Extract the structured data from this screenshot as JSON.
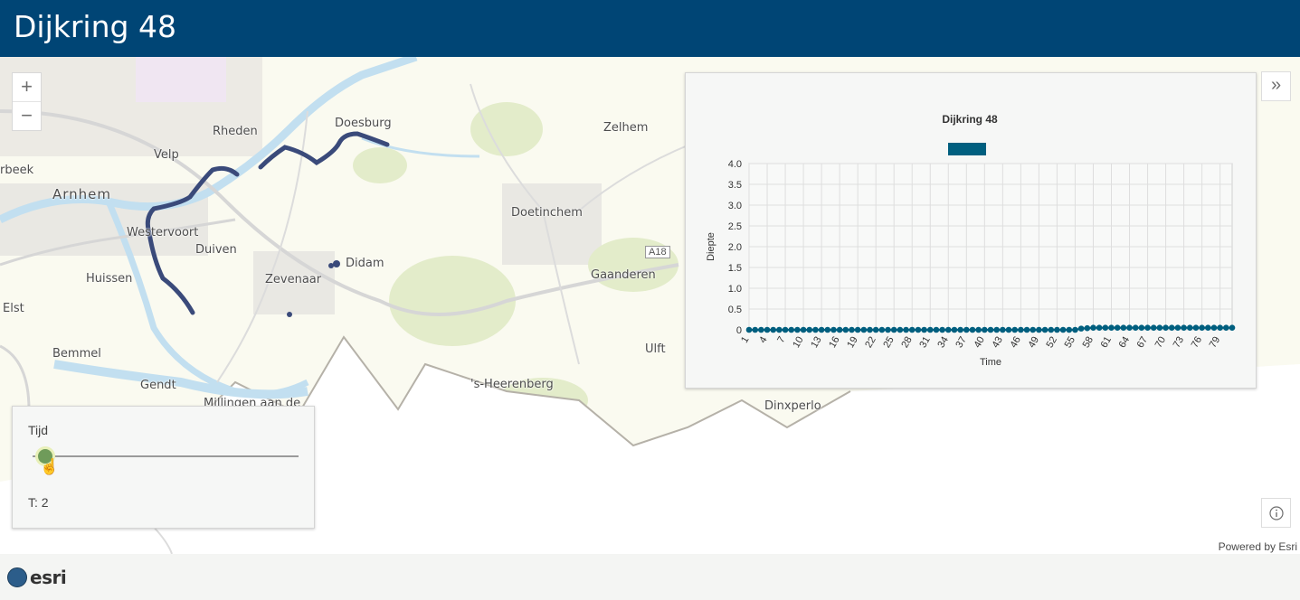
{
  "header": {
    "title": "Dijkring 48"
  },
  "map": {
    "places": {
      "doesburg": "Doesburg",
      "rheden": "Rheden",
      "velp": "Velp",
      "arnhem": "Arnhem",
      "rbeek": "rbeek",
      "westervoort": "Westervoort",
      "duiven": "Duiven",
      "didam": "Didam",
      "zevenaar": "Zevenaar",
      "huissen": "Huissen",
      "elst": "Elst",
      "bemmel": "Bemmel",
      "gendt": "Gendt",
      "millingen": "Millingen aan de",
      "doetinchem": "Doetinchem",
      "zelhem": "Zelhem",
      "gaanderen": "Gaanderen",
      "ulft": "Ulft",
      "heerenberg": "'s-Heerenberg",
      "dinxperlo": "Dinxperlo"
    },
    "road_shield": "A18",
    "zoom_in": "+",
    "zoom_out": "−"
  },
  "chart_data": {
    "type": "line",
    "title": "Dijkring 48",
    "xlabel": "Time",
    "ylabel": "Diepte",
    "ylim": [
      0,
      4.0
    ],
    "yticks": [
      "4.0",
      "3.5",
      "3.0",
      "2.5",
      "2.0",
      "1.5",
      "1.0",
      "0.5",
      "0"
    ],
    "xtick_labels": [
      "1",
      "4",
      "7",
      "10",
      "13",
      "16",
      "19",
      "22",
      "25",
      "28",
      "31",
      "34",
      "37",
      "40",
      "43",
      "46",
      "49",
      "52",
      "55",
      "58",
      "61",
      "64",
      "67",
      "70",
      "73",
      "76",
      "79"
    ],
    "series": [
      {
        "name": "",
        "color": "#005f7f",
        "x": [
          1,
          2,
          3,
          4,
          5,
          6,
          7,
          8,
          9,
          10,
          11,
          12,
          13,
          14,
          15,
          16,
          17,
          18,
          19,
          20,
          21,
          22,
          23,
          24,
          25,
          26,
          27,
          28,
          29,
          30,
          31,
          32,
          33,
          34,
          35,
          36,
          37,
          38,
          39,
          40,
          41,
          42,
          43,
          44,
          45,
          46,
          47,
          48,
          49,
          50,
          51,
          52,
          53,
          54,
          55,
          56,
          57,
          58,
          59,
          60,
          61,
          62,
          63,
          64,
          65,
          66,
          67,
          68,
          69,
          70,
          71,
          72,
          73,
          74,
          75,
          76,
          77,
          78,
          79,
          80,
          81
        ],
        "values": [
          0,
          0,
          0,
          0,
          0,
          0,
          0,
          0,
          0,
          0,
          0,
          0,
          0,
          0,
          0,
          0,
          0,
          0,
          0,
          0,
          0,
          0,
          0,
          0,
          0,
          0,
          0,
          0,
          0,
          0,
          0,
          0,
          0,
          0,
          0,
          0,
          0,
          0,
          0,
          0,
          0,
          0,
          0,
          0,
          0,
          0,
          0,
          0,
          0,
          0,
          0,
          0,
          0,
          0,
          0,
          0.03,
          0.04,
          0.05,
          0.05,
          0.05,
          0.05,
          0.05,
          0.05,
          0.05,
          0.05,
          0.05,
          0.05,
          0.05,
          0.05,
          0.05,
          0.05,
          0.05,
          0.05,
          0.05,
          0.05,
          0.05,
          0.05,
          0.05,
          0.05,
          0.05,
          0.05
        ]
      }
    ],
    "legend": "top-center",
    "grid": true
  },
  "time_slider": {
    "label": "Tijd",
    "value_text": "T: 2",
    "position": 0.02
  },
  "expand_icon": "»",
  "info_icon": "info-icon",
  "powered_by": "Powered by Esri",
  "footer": {
    "logo_text": "esri"
  }
}
